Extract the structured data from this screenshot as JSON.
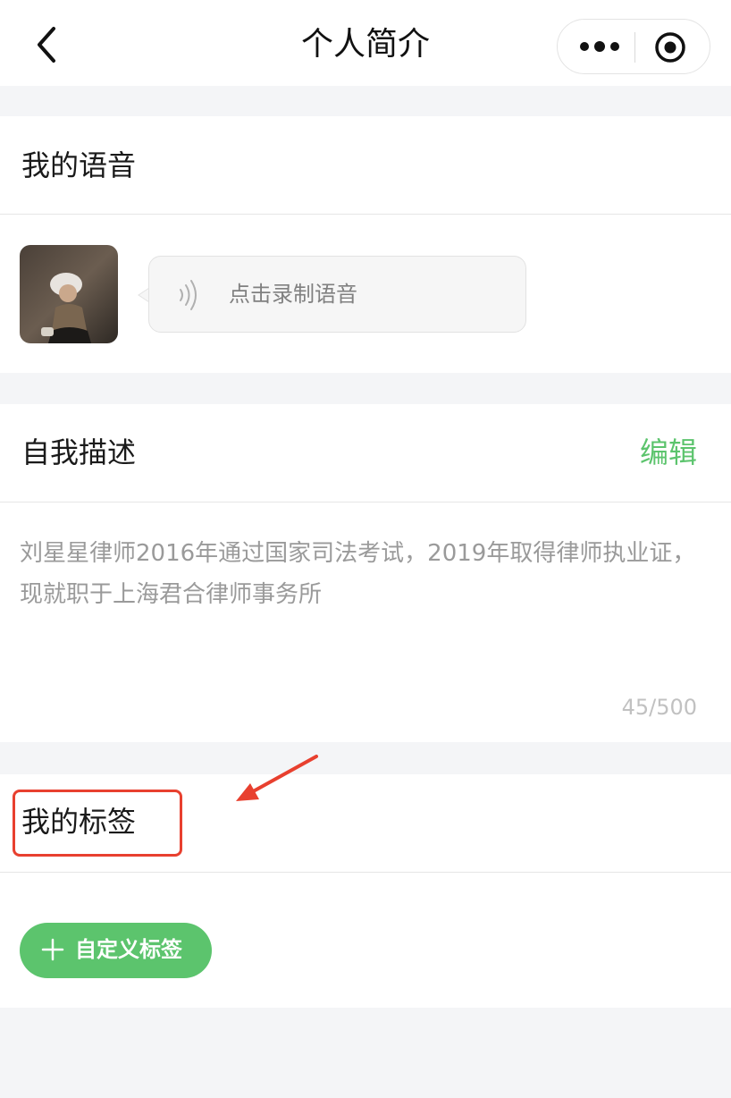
{
  "nav": {
    "title": "个人简介",
    "back_icon": "chevron-left-icon",
    "more_icon": "more-dots-icon",
    "close_icon": "target-circle-icon"
  },
  "voice": {
    "section_title": "我的语音",
    "record_label": "点击录制语音"
  },
  "description": {
    "section_title": "自我描述",
    "edit_label": "编辑",
    "text": "刘星星律师2016年通过国家司法考试，2019年取得律师执业证，现就职于上海君合律师事务所",
    "counter": "45/500"
  },
  "tags": {
    "section_title": "我的标签",
    "add_button_label": "自定义标签"
  },
  "colors": {
    "accent": "#5cc46d",
    "annotation": "#e8402f",
    "page_bg": "#f4f5f7"
  }
}
